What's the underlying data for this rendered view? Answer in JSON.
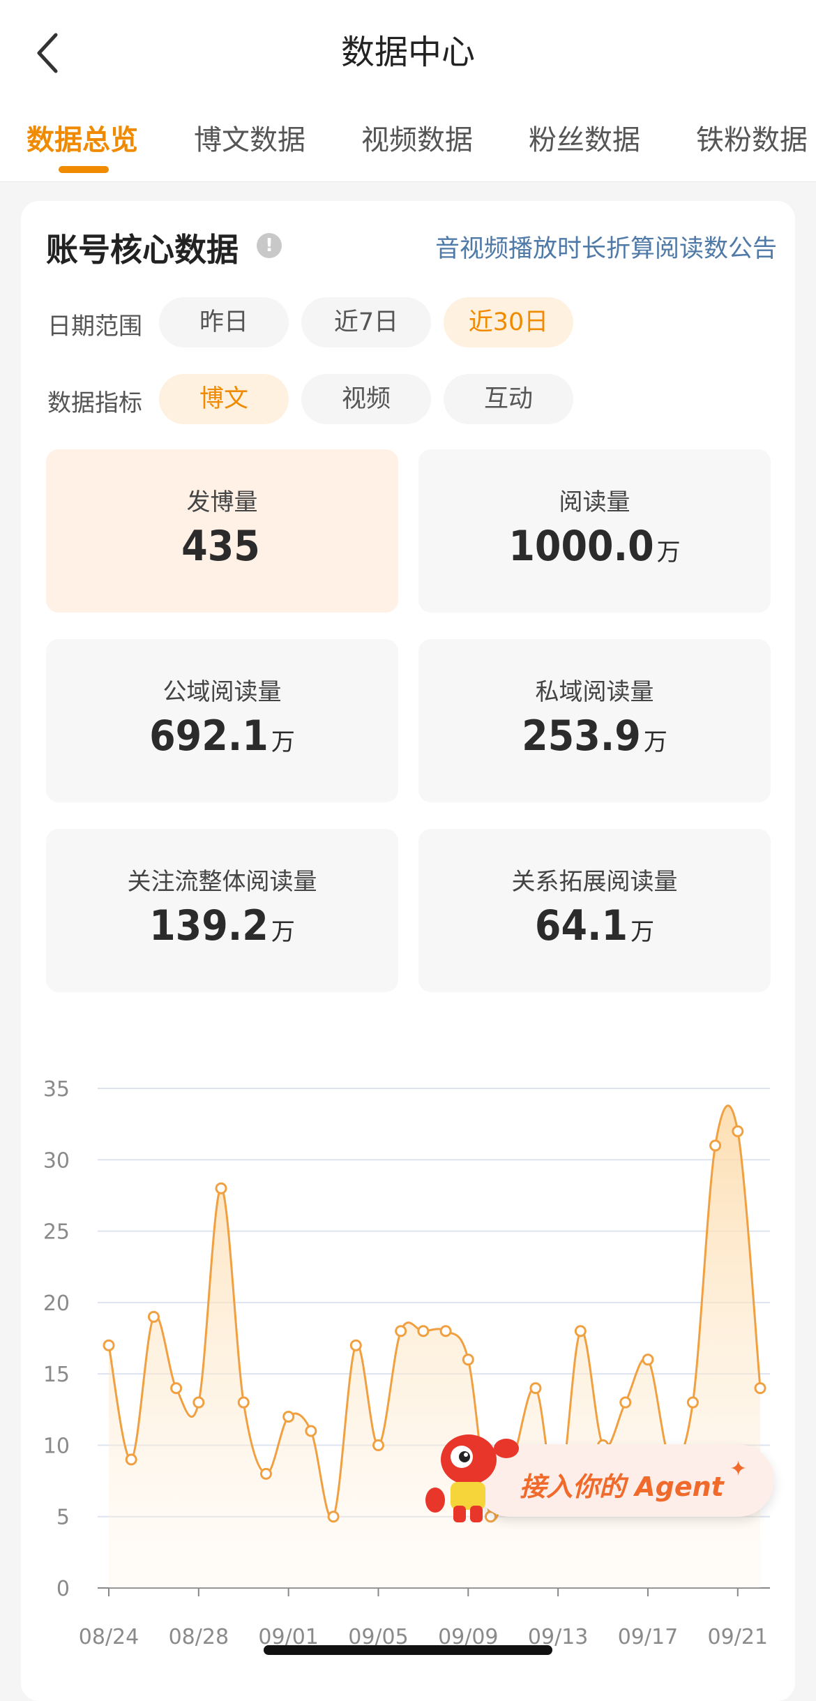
{
  "header": {
    "title": "数据中心"
  },
  "tabs": [
    {
      "label": "数据总览"
    },
    {
      "label": "博文数据"
    },
    {
      "label": "视频数据"
    },
    {
      "label": "粉丝数据"
    },
    {
      "label": "铁粉数据"
    }
  ],
  "card": {
    "title": "账号核心数据",
    "info_icon": "!",
    "notice_link": "音视频播放时长折算阅读数公告"
  },
  "date_range": {
    "label": "日期范围",
    "options": [
      "昨日",
      "近7日",
      "近30日"
    ],
    "selected": "近30日"
  },
  "metric_type": {
    "label": "数据指标",
    "options": [
      "博文",
      "视频",
      "互动"
    ],
    "selected": "博文"
  },
  "metrics": [
    {
      "label": "发博量",
      "value": "435",
      "unit": ""
    },
    {
      "label": "阅读量",
      "value": "1000.0",
      "unit": "万"
    },
    {
      "label": "公域阅读量",
      "value": "692.1",
      "unit": "万"
    },
    {
      "label": "私域阅读量",
      "value": "253.9",
      "unit": "万"
    },
    {
      "label": "关注流整体阅读量",
      "value": "139.2",
      "unit": "万"
    },
    {
      "label": "关系拓展阅读量",
      "value": "64.1",
      "unit": "万"
    }
  ],
  "chart_data": {
    "type": "area",
    "x_tick_labels": [
      "08/24",
      "08/28",
      "09/01",
      "09/05",
      "09/09",
      "09/13",
      "09/17",
      "09/21"
    ],
    "y_tick_labels": [
      "0",
      "5",
      "10",
      "15",
      "20",
      "25",
      "30",
      "35"
    ],
    "ylim": [
      0,
      35
    ],
    "grid": true,
    "series": [
      {
        "x": [
          "08/24",
          "08/25",
          "08/26",
          "08/27",
          "08/28",
          "08/29",
          "08/30",
          "08/31",
          "09/01",
          "09/02",
          "09/03",
          "09/04",
          "09/05",
          "09/06",
          "09/07",
          "09/08",
          "09/09",
          "09/10",
          "09/11",
          "09/12",
          "09/13",
          "09/14",
          "09/15",
          "09/16",
          "09/17",
          "09/18",
          "09/19",
          "09/20",
          "09/21",
          "09/22"
        ],
        "values": [
          17,
          9,
          19,
          14,
          13,
          28,
          13,
          8,
          12,
          11,
          5,
          17,
          10,
          18,
          18,
          18,
          16,
          5,
          9,
          14,
          6,
          18,
          10,
          13,
          16,
          9,
          13,
          31,
          32,
          14
        ]
      }
    ],
    "line_color": "#f0a040",
    "fill_color": "#fde2b8"
  },
  "agent": {
    "label": "接入你的 Agent",
    "sparkle": "✦"
  }
}
